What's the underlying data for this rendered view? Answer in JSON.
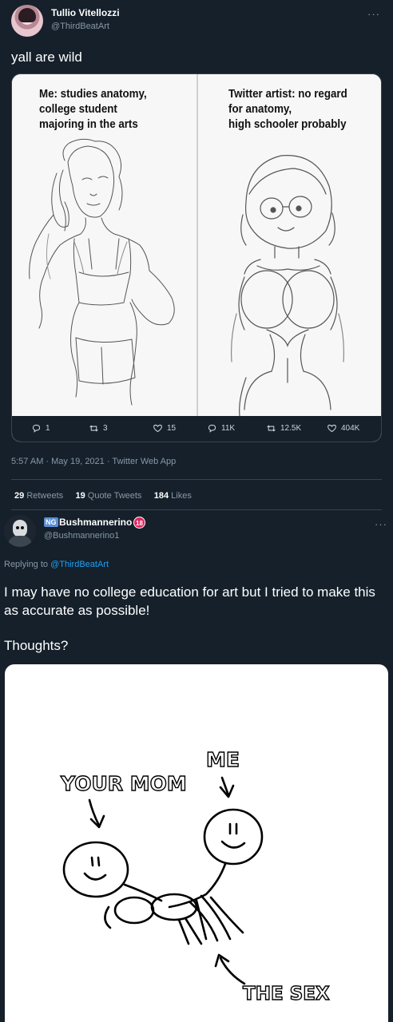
{
  "tweet": {
    "author_name": "Tullio Vitellozzi",
    "author_handle": "@ThirdBeatArt",
    "more_label": "···",
    "text": "yall are wild",
    "image": {
      "left_caption": [
        "Me: studies anatomy,",
        "college student",
        "majoring in the arts"
      ],
      "right_caption": [
        "Twitter artist: no regard",
        "for anatomy,",
        "high schooler probably"
      ],
      "left_stats": {
        "replies": "1",
        "retweets": "3",
        "likes": "15"
      },
      "right_stats": {
        "replies": "11K",
        "retweets": "12.5K",
        "likes": "404K"
      }
    },
    "timestamp": "5:57 AM · May 19, 2021 · Twitter Web App",
    "counts": {
      "retweets_num": "29",
      "retweets_label": "Retweets",
      "quotes_num": "19",
      "quotes_label": "Quote Tweets",
      "likes_num": "184",
      "likes_label": "Likes"
    }
  },
  "reply": {
    "badge_ng": "NG",
    "author_name": "Bushmannerino",
    "badge_18": "18",
    "author_handle": "@Bushmannerino1",
    "more_label": "···",
    "replying_prefix": "Replying to",
    "replying_to": "@ThirdBeatArt",
    "text_line1": "I may have no college education for art but I tried to make this as accurate as possible!",
    "text_line2": "Thoughts?",
    "drawing_labels": {
      "your_mom": "YOUR MOM",
      "me": "ME",
      "the_sex": "THE SEX"
    }
  },
  "colors": {
    "background": "#15202b",
    "muted": "#8899a6",
    "link": "#1da1f2",
    "border": "#38444d"
  }
}
